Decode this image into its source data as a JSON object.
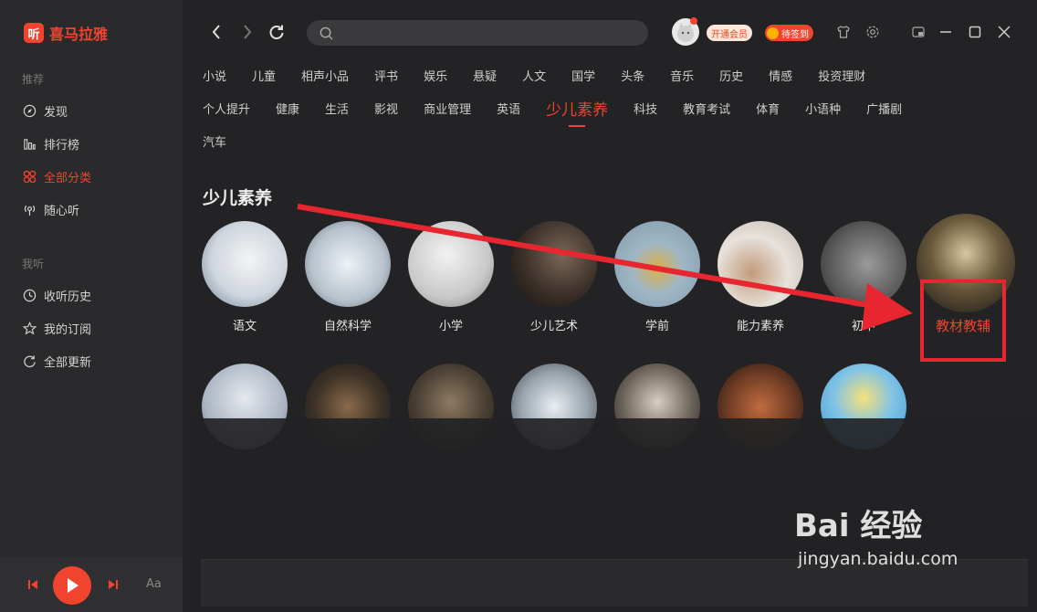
{
  "app": {
    "logo_badge": "听",
    "logo_text": "喜马拉雅"
  },
  "sidebar": {
    "section_recommend": "推荐",
    "section_mine": "我听",
    "items": [
      {
        "label": "发现",
        "icon": "compass-icon"
      },
      {
        "label": "排行榜",
        "icon": "bar-chart-icon"
      },
      {
        "label": "全部分类",
        "icon": "grid-icon",
        "active": true
      },
      {
        "label": "随心听",
        "icon": "radio-icon"
      },
      {
        "label": "收听历史",
        "icon": "clock-icon"
      },
      {
        "label": "我的订阅",
        "icon": "star-icon"
      },
      {
        "label": "全部更新",
        "icon": "refresh-icon"
      }
    ]
  },
  "player": {
    "font_toggle": "Aa"
  },
  "topbar": {
    "search_placeholder": "",
    "vip_label": "开通会员",
    "checkin_label": "待签到"
  },
  "categories": {
    "row1": [
      "小说",
      "儿童",
      "相声小品",
      "评书",
      "娱乐",
      "悬疑",
      "人文",
      "国学",
      "头条",
      "音乐",
      "历史",
      "情感",
      "投资理财"
    ],
    "row2": [
      "个人提升",
      "健康",
      "生活",
      "影视",
      "商业管理",
      "英语",
      "少儿素养",
      "科技",
      "教育考试",
      "体育",
      "小语种",
      "广播剧"
    ],
    "row3": [
      "汽车"
    ],
    "active": "少儿素养"
  },
  "section": {
    "title": "少儿素养"
  },
  "subcategories": [
    "语文",
    "自然科学",
    "小学",
    "少儿艺术",
    "学前",
    "能力素养",
    "初中",
    "教材教辅"
  ],
  "annotation": {
    "label": "教材教辅",
    "color": "#e8262f"
  },
  "watermark": {
    "main": "Bai 经验",
    "sub": "jingyan.baidu.com"
  },
  "colors": {
    "accent": "#f0442f",
    "background": "#232325",
    "sidebar": "#2a2a2c"
  }
}
